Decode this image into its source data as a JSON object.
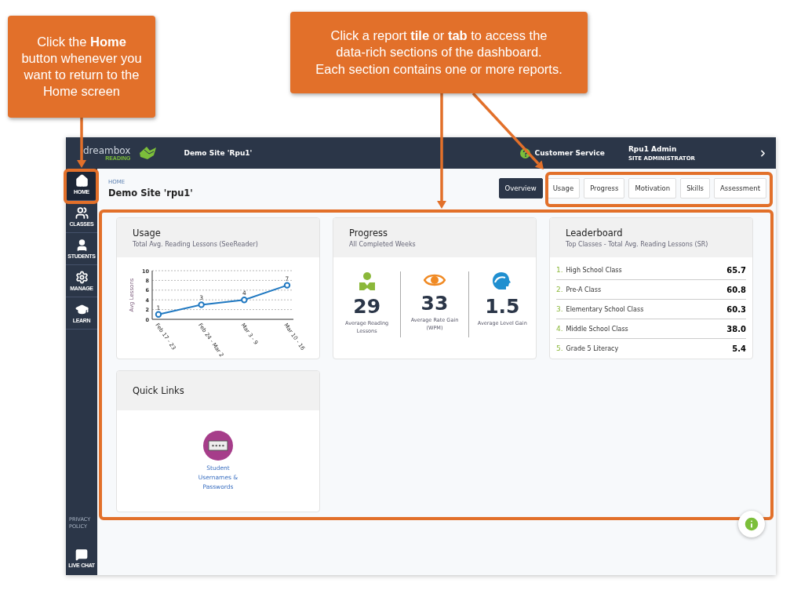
{
  "callouts": [
    {
      "text": "Click the **Home**\nbutton whenever you\nwant to return to the\nHome screen"
    },
    {
      "text": "Click a report **tile** or **tab** to access the\ndata-rich sections of the dashboard.\nEach section contains one or more reports."
    }
  ],
  "topbar": {
    "logo": "dreambox",
    "logo_sub": "READING",
    "site": "Demo Site 'Rpu1'",
    "help": "Customer Service",
    "user": "Rpu1 Admin",
    "role": "SITE ADMINISTRATOR"
  },
  "sidebar": {
    "items": [
      {
        "label": "HOME",
        "selected": true
      },
      {
        "label": "CLASSES",
        "selected": false
      },
      {
        "label": "STUDENTS",
        "selected": false
      },
      {
        "label": "MANAGE",
        "selected": false
      },
      {
        "label": "LEARN",
        "selected": false
      }
    ],
    "privacy": "PRIVACY POLICY",
    "chat": "LIVE CHAT"
  },
  "header": {
    "breadcrumb": "HOME",
    "title": "Demo Site 'rpu1'",
    "tabs": [
      {
        "label": "Overview",
        "selected": true
      },
      {
        "label": "Usage",
        "selected": false
      },
      {
        "label": "Progress",
        "selected": false
      },
      {
        "label": "Motivation",
        "selected": false
      },
      {
        "label": "Skills",
        "selected": false
      },
      {
        "label": "Assessment",
        "selected": false
      }
    ]
  },
  "usage": {
    "title": "Usage",
    "subtitle": "Total Avg. Reading Lessons (SeeReader)",
    "chart_data": {
      "type": "line",
      "ylabel": "Avg Lessons",
      "categories": [
        "Feb 17 - 23",
        "Feb 24 - Mar 2",
        "Mar 3 - 9",
        "Mar 10 - 16"
      ],
      "series": [
        {
          "color": "#1f78c1",
          "marker": "o",
          "values": [
            1,
            3,
            4,
            7
          ]
        }
      ],
      "ylim": [
        0,
        10
      ],
      "yticks": [
        0,
        2,
        4,
        6,
        8,
        10
      ],
      "grid": true,
      "data_labels": true
    }
  },
  "progress": {
    "title": "Progress",
    "subtitle": "All Completed Weeks",
    "stats": [
      {
        "value": "29",
        "label": "Average Reading Lessons"
      },
      {
        "value": "33",
        "label": "Average Rate Gain (WPM)"
      },
      {
        "value": "1.5",
        "label": "Average Level Gain"
      }
    ]
  },
  "leaderboard": {
    "title": "Leaderboard",
    "subtitle": "Top Classes - Total Avg. Reading Lessons (SR)",
    "rows": [
      {
        "rank": "1.",
        "name": "High School Class",
        "value": "65.7"
      },
      {
        "rank": "2.",
        "name": "Pre-A Class",
        "value": "60.8"
      },
      {
        "rank": "3.",
        "name": "Elementary School Class",
        "value": "60.3"
      },
      {
        "rank": "4.",
        "name": "Middle School Class",
        "value": "38.0"
      },
      {
        "rank": "5.",
        "name": "Grade 5 Literacy",
        "value": "5.4"
      }
    ]
  },
  "quick_links": {
    "title": "Quick Links",
    "links": [
      {
        "label": "Student Usernames & Passwords"
      }
    ]
  }
}
